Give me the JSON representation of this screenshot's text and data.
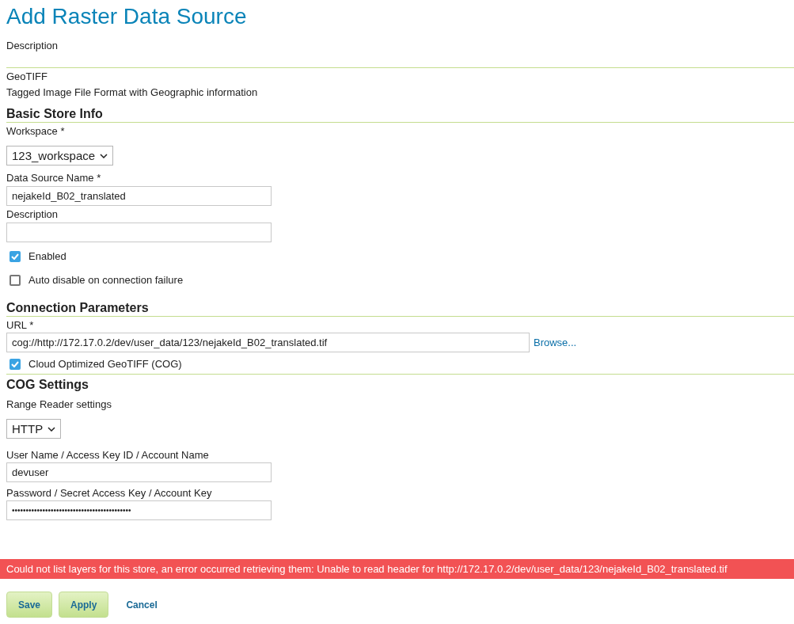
{
  "title": "Add Raster Data Source",
  "description_label": "Description",
  "source_type": {
    "name": "GeoTIFF",
    "description": "Tagged Image File Format with Geographic information"
  },
  "basic_store_info": {
    "heading": "Basic Store Info",
    "workspace": {
      "label": "Workspace *",
      "value": "123_workspace"
    },
    "data_source_name": {
      "label": "Data Source Name *",
      "value": "nejakeId_B02_translated"
    },
    "description": {
      "label": "Description"
    },
    "checkboxes": [
      {
        "label": "Enabled",
        "checked": true
      },
      {
        "label": "Auto disable on connection failure",
        "checked": false
      }
    ]
  },
  "connection_parameters": {
    "heading": "Connection Parameters",
    "url": {
      "label": "URL *",
      "value": "cog://http://172.17.0.2/dev/user_data/123/nejakeId_B02_translated.tif"
    },
    "browse_link": "Browse...",
    "cog_checkbox": {
      "label": "Cloud Optimized GeoTIFF (COG)",
      "checked": true
    }
  },
  "cog_settings": {
    "heading": "COG Settings",
    "range_reader": {
      "label": "Range Reader settings",
      "value": "HTTP"
    },
    "username": {
      "label": "User Name / Access Key ID / Account Name",
      "value": "devuser"
    },
    "password": {
      "label": "Password / Secret Access Key / Account Key",
      "value": "•••••••••••••••••••••••••••••••••••••••••••"
    }
  },
  "error_message": "Could not list layers for this store, an error occurred retrieving them: Unable to read header for http://172.17.0.2/dev/user_data/123/nejakeId_B02_translated.tif",
  "buttons": [
    {
      "label": "Save",
      "kind": "primary"
    },
    {
      "label": "Apply",
      "kind": "primary"
    },
    {
      "label": "Cancel",
      "kind": "link"
    }
  ]
}
